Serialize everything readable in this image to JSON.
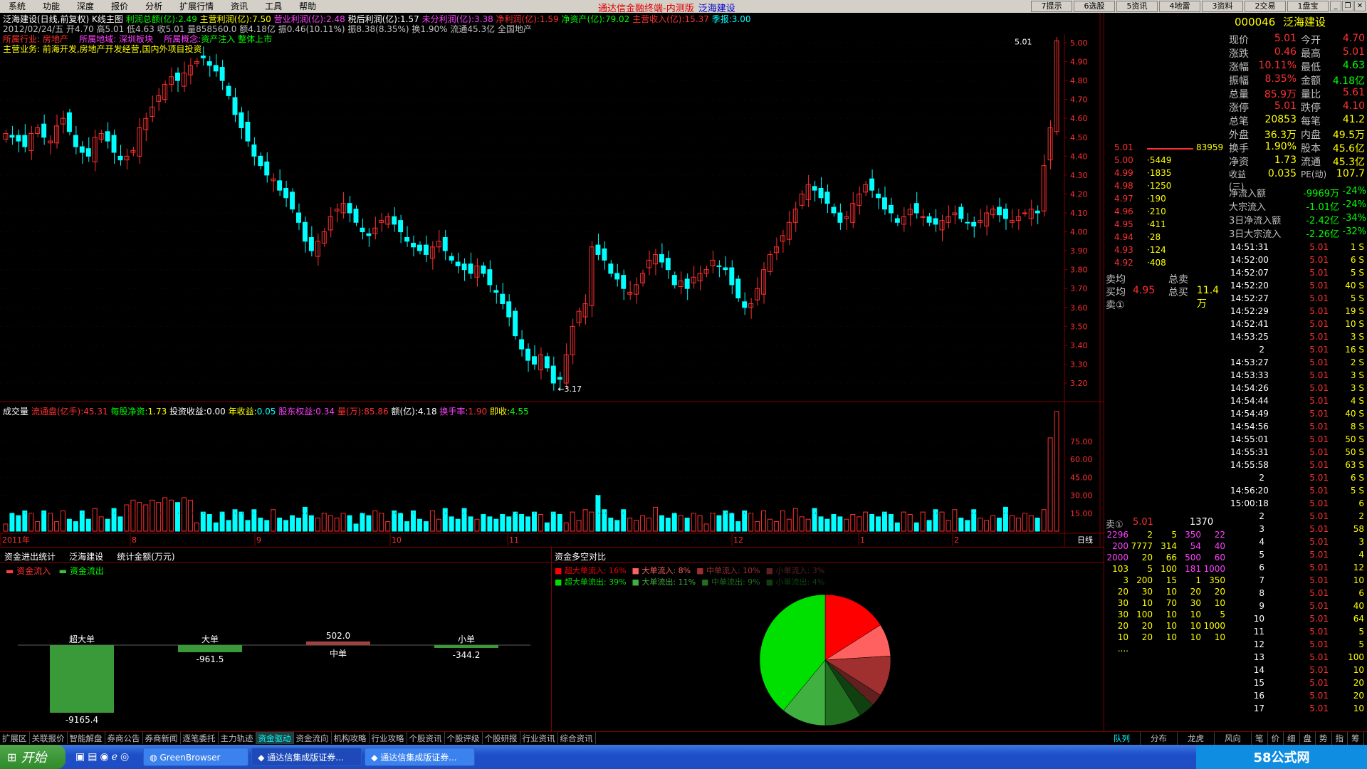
{
  "menu": {
    "items": [
      "系统",
      "功能",
      "深度",
      "报价",
      "分析",
      "扩展行情",
      "资讯",
      "工具",
      "帮助"
    ],
    "title": "通达信金融终端-内测版",
    "stock_name": "泛海建设",
    "top_buttons": [
      "7提示",
      "6选股",
      "5资讯",
      "4地雷",
      "3资料",
      "2交易",
      "1盘宝"
    ]
  },
  "chart": {
    "header1": {
      "name": "泛海建设(日线,前复权) K线主图",
      "lirun_label": "利润总额(亿):",
      "lirun_value": "2.49",
      "zhuying_lirun_label": "主营利润(亿):",
      "zhuying_lirun_value": "7.50",
      "yingye_label": "营业利润(亿):",
      "yingye_value": "2.48",
      "shuihou_label": "税后利润(亿):",
      "shuihou_value": "1.57",
      "weifen_label": "未分利润(亿):",
      "weifen_value": "3.38",
      "jinglirun_label": "净利润(亿):",
      "jinglirun_value": "1.59",
      "jingzichan_label": "净资产(亿):",
      "jingzichan_value": "79.02",
      "shouru_label": "主营收入(亿):",
      "shouru_value": "15.37",
      "jibao_label": "季报:",
      "jibao_value": "3.00"
    },
    "header2": "2012/02/24/五 开4.70 高5.01 低4.63 收5.01 量858560.0 额4.18亿 振0.46(10.11%) 振8.38(8.35%) 换1.90% 流通45.3亿 全国地产",
    "header3": {
      "hangye": "所属行业: 房地产",
      "diyu": "所属地域: 深圳板块",
      "gainian_label": "所属概念:",
      "gainian_value": "资产注入 整体上市"
    },
    "header4": "主营业务: 前海开发,房地产开发经营,国内外项目投资",
    "high_label": "5.01",
    "low_label": "←3.17",
    "y_ticks": [
      "5.00",
      "4.90",
      "4.80",
      "4.70",
      "4.60",
      "4.50",
      "4.40",
      "4.30",
      "4.20",
      "4.10",
      "4.00",
      "3.90",
      "3.80",
      "3.70",
      "3.60",
      "3.50",
      "3.40",
      "3.30",
      "3.20"
    ],
    "volume_header": {
      "label": "成交量",
      "liutong_label": "流通盘(亿手):",
      "liutong_value": "45.31",
      "meigu_label": "每股净资:",
      "meigu_value": "1.73",
      "touzi_label": "投资收益:",
      "touzi_value": "0.00",
      "nianshou_label": "年收益:",
      "nianshou_value": "0.05",
      "gudong_label": "股东权益:",
      "gudong_value": "0.34",
      "liang_label": "量(万):",
      "liang_value": "85.86",
      "e_label": "额(亿):",
      "e_value": "4.18",
      "huanshou_label": "换手率:",
      "huanshou_value": "1.90",
      "jishou_label": "即收:",
      "jishou_value": "4.55"
    },
    "vol_ticks": [
      "75.00",
      "60.00",
      "45.00",
      "30.00",
      "15.00"
    ],
    "x_labels": [
      "2011年",
      "8",
      "9",
      "10",
      "11",
      "12",
      "1",
      "2"
    ],
    "period": "日线"
  },
  "funds": {
    "title": "资金进出统计",
    "stock": "泛海建设",
    "unit": "统计金额(万元)",
    "legend_in": "资金流入",
    "legend_out": "资金流出",
    "groups": [
      {
        "name": "超大单",
        "value": "-9165.4",
        "amount": -9165.4
      },
      {
        "name": "大单",
        "value": "-961.5",
        "amount": -961.5
      },
      {
        "name": "中单",
        "value": "502.0",
        "amount": 502.0
      },
      {
        "name": "小单",
        "value": "-344.2",
        "amount": -344.2
      }
    ]
  },
  "pie": {
    "title": "资金多空对比",
    "legend_row1": [
      {
        "label": "超大单流入:",
        "value": "16%",
        "color": "#ff0000"
      },
      {
        "label": "大单流入:",
        "value": "8%",
        "color": "#ff6060"
      },
      {
        "label": "中单流入:",
        "value": "10%",
        "color": "#a03030"
      },
      {
        "label": "小单流入:",
        "value": "3%",
        "color": "#602020"
      }
    ],
    "legend_row2": [
      {
        "label": "超大单流出:",
        "value": "39%",
        "color": "#00e000"
      },
      {
        "label": "大单流出:",
        "value": "11%",
        "color": "#40b040"
      },
      {
        "label": "中单流出:",
        "value": "9%",
        "color": "#207020"
      },
      {
        "label": "小单流出:",
        "value": "4%",
        "color": "#104010"
      }
    ]
  },
  "quote": {
    "code": "000046",
    "name": "泛海建设",
    "rows": [
      [
        "现价",
        "5.01",
        "今开",
        "4.70"
      ],
      [
        "涨跌",
        "0.46",
        "最高",
        "5.01"
      ],
      [
        "涨幅",
        "10.11%",
        "最低",
        "4.63"
      ],
      [
        "振幅",
        "8.35%",
        "金额",
        "4.18亿"
      ],
      [
        "总量",
        "85.9万",
        "量比",
        "5.61"
      ],
      [
        "涨停",
        "5.01",
        "跌停",
        "4.10"
      ],
      [
        "总笔",
        "20853",
        "每笔",
        "41.2"
      ],
      [
        "外盘",
        "36.3万",
        "内盘",
        "49.5万"
      ],
      [
        "换手",
        "1.90%",
        "股本",
        "45.6亿"
      ],
      [
        "净资",
        "1.73",
        "流通",
        "45.3亿"
      ],
      [
        "收益(三)",
        "0.035",
        "PE(动)",
        "107.7"
      ]
    ],
    "flows": [
      [
        "净流入额",
        "-9969万",
        "-24%"
      ],
      [
        "大宗流入",
        "-1.01亿",
        "-24%"
      ],
      [
        "3日净流入额",
        "-2.42亿",
        "-34%"
      ],
      [
        "3日大宗流入",
        "-2.26亿",
        "-32%"
      ]
    ]
  },
  "orderbook": {
    "top_price": "5.01",
    "top_vol": "83959",
    "rows": [
      [
        "5.00",
        "5449"
      ],
      [
        "4.99",
        "1835"
      ],
      [
        "4.98",
        "1250"
      ],
      [
        "4.97",
        "190"
      ],
      [
        "4.96",
        "210"
      ],
      [
        "4.95",
        "411"
      ],
      [
        "4.94",
        "28"
      ],
      [
        "4.93",
        "124"
      ],
      [
        "4.92",
        "408"
      ]
    ],
    "sell_avg_label": "卖均",
    "total_sell_label": "总卖",
    "buy_avg_label": "买均",
    "buy_avg": "4.95",
    "total_buy_label": "总买",
    "total_buy": "11.4万",
    "sell1_label": "卖①",
    "bottom_sell_label": "卖①",
    "bottom_sell_price": "5.01",
    "bottom_sell_vol": "1370",
    "queue": [
      [
        "2296",
        "2",
        "5",
        "350",
        "22"
      ],
      [
        "200",
        "7777",
        "314",
        "54",
        "40"
      ],
      [
        "2000",
        "20",
        "66",
        "500",
        "60"
      ],
      [
        "103",
        "5",
        "100",
        "181",
        "1000"
      ],
      [
        "3",
        "200",
        "15",
        "1",
        "350"
      ],
      [
        "20",
        "30",
        "10",
        "20",
        "20"
      ],
      [
        "30",
        "10",
        "70",
        "30",
        "10"
      ],
      [
        "30",
        "100",
        "10",
        "10",
        "5"
      ],
      [
        "20",
        "20",
        "10",
        "10",
        "1000"
      ],
      [
        "10",
        "20",
        "10",
        "10",
        "10"
      ],
      [
        "....",
        "",
        "",
        "",
        ""
      ]
    ]
  },
  "trades": [
    [
      "14:51:31",
      "5.01",
      "1 S"
    ],
    [
      "14:52:00",
      "5.01",
      "6 S"
    ],
    [
      "14:52:07",
      "5.01",
      "5 S"
    ],
    [
      "14:52:20",
      "5.01",
      "40 S"
    ],
    [
      "14:52:27",
      "5.01",
      "5 S"
    ],
    [
      "14:52:29",
      "5.01",
      "19 S"
    ],
    [
      "14:52:41",
      "5.01",
      "10 S"
    ],
    [
      "14:53:25",
      "5.01",
      "3 S"
    ],
    [
      "2",
      "5.01",
      "16 S"
    ],
    [
      "14:53:27",
      "5.01",
      "2 S"
    ],
    [
      "14:53:33",
      "5.01",
      "3 S"
    ],
    [
      "14:54:26",
      "5.01",
      "3 S"
    ],
    [
      "14:54:44",
      "5.01",
      "4 S"
    ],
    [
      "14:54:49",
      "5.01",
      "40 S"
    ],
    [
      "14:54:56",
      "5.01",
      "8 S"
    ],
    [
      "14:55:01",
      "5.01",
      "50 S"
    ],
    [
      "14:55:31",
      "5.01",
      "50 S"
    ],
    [
      "14:55:58",
      "5.01",
      "63 S"
    ],
    [
      "2",
      "5.01",
      "6 S"
    ],
    [
      "14:56:20",
      "5.01",
      "5 S"
    ],
    [
      "15:00:18",
      "5.01",
      "6"
    ],
    [
      "2",
      "5.01",
      "2"
    ],
    [
      "3",
      "5.01",
      "58"
    ],
    [
      "4",
      "5.01",
      "3"
    ],
    [
      "5",
      "5.01",
      "4"
    ],
    [
      "6",
      "5.01",
      "12"
    ],
    [
      "7",
      "5.01",
      "10"
    ],
    [
      "8",
      "5.01",
      "6"
    ],
    [
      "9",
      "5.01",
      "40"
    ],
    [
      "10",
      "5.01",
      "64"
    ],
    [
      "11",
      "5.01",
      "5"
    ],
    [
      "12",
      "5.01",
      "5"
    ],
    [
      "13",
      "5.01",
      "100"
    ],
    [
      "14",
      "5.01",
      "10"
    ],
    [
      "15",
      "5.01",
      "20"
    ],
    [
      "16",
      "5.01",
      "20"
    ],
    [
      "17",
      "5.01",
      "10"
    ]
  ],
  "bottom_tabs": [
    "扩展区",
    "关联报价",
    "智能解盘",
    "券商公告",
    "券商新闻",
    "逐笔委托",
    "主力轨迹",
    "资金驱动",
    "资金流向",
    "机构攻略",
    "行业攻略",
    "个股资讯",
    "个股评级",
    "个股研报",
    "行业资讯",
    "综合资讯"
  ],
  "right_tabs": [
    "队列",
    "分布",
    "龙虎",
    "风向",
    "笔",
    "价",
    "细",
    "盘",
    "势",
    "指",
    "筹"
  ],
  "taskbar": {
    "start": "开始",
    "tasks": [
      "GreenBrowser",
      "通达信集成版证券...",
      "通达信集成版证券..."
    ],
    "watermark": "58公式网"
  }
}
